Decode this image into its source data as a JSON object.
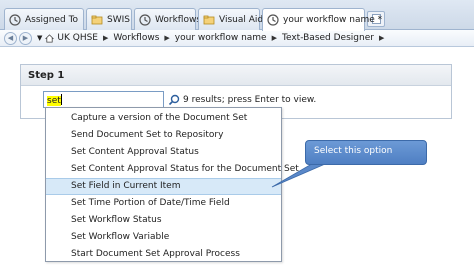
{
  "tabs": [
    {
      "label": "Assigned To",
      "icon": "workflow-icon"
    },
    {
      "label": "SWIS",
      "icon": "folder-icon"
    },
    {
      "label": "Workflows",
      "icon": "workflow-icon"
    },
    {
      "label": "Visual Aids",
      "icon": "folder-icon"
    },
    {
      "label": "your workflow name *",
      "icon": "workflow-icon",
      "active": true
    }
  ],
  "breadcrumb": {
    "items": [
      "UK QHSE",
      "Workflows",
      "your workflow name",
      "Text-Based Designer"
    ]
  },
  "step": {
    "title": "Step 1",
    "search_value": "set",
    "results_text": "9 results; press Enter to view."
  },
  "dropdown": {
    "items": [
      "Capture a version of the Document Set",
      "Send Document Set to Repository",
      "Set Content Approval Status",
      "Set Content Approval Status for the Document Set",
      "Set Field in Current Item",
      "Set Time Portion of Date/Time Field",
      "Set Workflow Status",
      "Set Workflow Variable",
      "Start Document Set Approval Process"
    ],
    "selected_index": 4
  },
  "callout": {
    "text": "Select this option"
  },
  "colors": {
    "accent": "#4f7fc3",
    "highlight": "#ffff00",
    "selected_row": "#d7e9f8"
  }
}
